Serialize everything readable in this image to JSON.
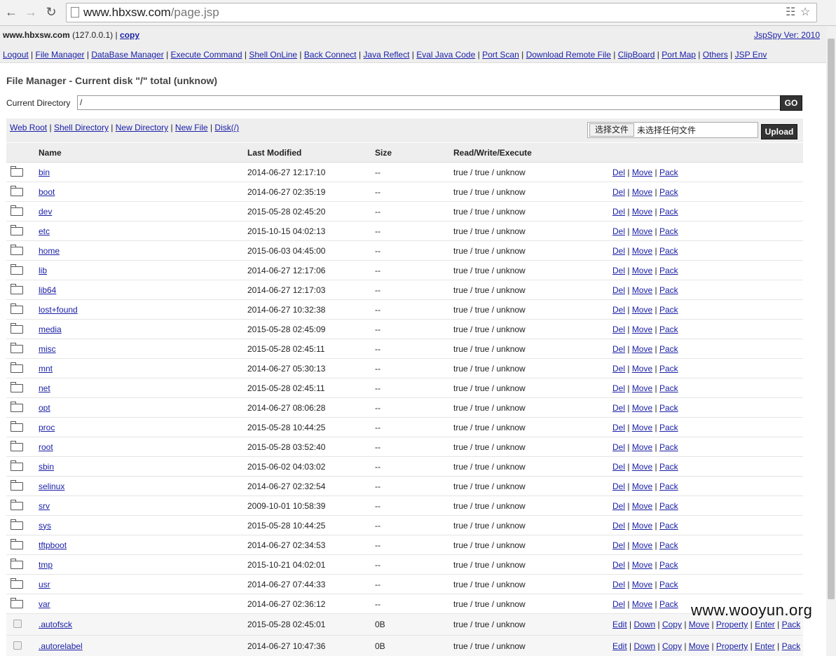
{
  "browser": {
    "url_host": "www.hbxsw.com",
    "url_path": "/page.jsp",
    "back_icon": "arrow-left",
    "forward_icon": "arrow-right",
    "reload_icon": "reload"
  },
  "header": {
    "host": "www.hbxsw.com",
    "ip": "(127.0.0.1)",
    "copy": "copy",
    "version": "JspSpy Ver: 2010"
  },
  "menu": [
    "Logout",
    "File Manager",
    "DataBase Manager",
    "Execute Command",
    "Shell OnLine",
    "Back Connect",
    "Java Reflect",
    "Eval Java Code",
    "Port Scan",
    "Download Remote File",
    "ClipBoard",
    "Port Map",
    "Others",
    "JSP Env"
  ],
  "title": "File Manager - Current disk \"/\" total (unknow)",
  "current_directory": {
    "label": "Current Directory",
    "value": "/",
    "go": "GO"
  },
  "tools": [
    "Web Root",
    "Shell Directory",
    "New Directory",
    "New File",
    "Disk(/)"
  ],
  "upload": {
    "choose": "选择文件",
    "no_file": "未选择任何文件",
    "button": "Upload"
  },
  "columns": {
    "name": "Name",
    "modified": "Last Modified",
    "size": "Size",
    "perm": "Read/Write/Execute"
  },
  "dir_actions": [
    "Del",
    "Move",
    "Pack"
  ],
  "file_actions": [
    "Edit",
    "Down",
    "Copy",
    "Move",
    "Property",
    "Enter",
    "Pack"
  ],
  "dirs": [
    {
      "name": "bin",
      "modified": "2014-06-27 12:17:10",
      "size": "--",
      "perm": "true / true / unknow"
    },
    {
      "name": "boot",
      "modified": "2014-06-27 02:35:19",
      "size": "--",
      "perm": "true / true / unknow"
    },
    {
      "name": "dev",
      "modified": "2015-05-28 02:45:20",
      "size": "--",
      "perm": "true / true / unknow"
    },
    {
      "name": "etc",
      "modified": "2015-10-15 04:02:13",
      "size": "--",
      "perm": "true / true / unknow"
    },
    {
      "name": "home",
      "modified": "2015-06-03 04:45:00",
      "size": "--",
      "perm": "true / true / unknow"
    },
    {
      "name": "lib",
      "modified": "2014-06-27 12:17:06",
      "size": "--",
      "perm": "true / true / unknow"
    },
    {
      "name": "lib64",
      "modified": "2014-06-27 12:17:03",
      "size": "--",
      "perm": "true / true / unknow"
    },
    {
      "name": "lost+found",
      "modified": "2014-06-27 10:32:38",
      "size": "--",
      "perm": "true / true / unknow"
    },
    {
      "name": "media",
      "modified": "2015-05-28 02:45:09",
      "size": "--",
      "perm": "true / true / unknow"
    },
    {
      "name": "misc",
      "modified": "2015-05-28 02:45:11",
      "size": "--",
      "perm": "true / true / unknow"
    },
    {
      "name": "mnt",
      "modified": "2014-06-27 05:30:13",
      "size": "--",
      "perm": "true / true / unknow"
    },
    {
      "name": "net",
      "modified": "2015-05-28 02:45:11",
      "size": "--",
      "perm": "true / true / unknow"
    },
    {
      "name": "opt",
      "modified": "2014-06-27 08:06:28",
      "size": "--",
      "perm": "true / true / unknow"
    },
    {
      "name": "proc",
      "modified": "2015-05-28 10:44:25",
      "size": "--",
      "perm": "true / true / unknow"
    },
    {
      "name": "root",
      "modified": "2015-05-28 03:52:40",
      "size": "--",
      "perm": "true / true / unknow"
    },
    {
      "name": "sbin",
      "modified": "2015-06-02 04:03:02",
      "size": "--",
      "perm": "true / true / unknow"
    },
    {
      "name": "selinux",
      "modified": "2014-06-27 02:32:54",
      "size": "--",
      "perm": "true / true / unknow"
    },
    {
      "name": "srv",
      "modified": "2009-10-01 10:58:39",
      "size": "--",
      "perm": "true / true / unknow"
    },
    {
      "name": "sys",
      "modified": "2015-05-28 10:44:25",
      "size": "--",
      "perm": "true / true / unknow"
    },
    {
      "name": "tftpboot",
      "modified": "2014-06-27 02:34:53",
      "size": "--",
      "perm": "true / true / unknow"
    },
    {
      "name": "tmp",
      "modified": "2015-10-21 04:02:01",
      "size": "--",
      "perm": "true / true / unknow"
    },
    {
      "name": "usr",
      "modified": "2014-06-27 07:44:33",
      "size": "--",
      "perm": "true / true / unknow"
    },
    {
      "name": "var",
      "modified": "2014-06-27 02:36:12",
      "size": "--",
      "perm": "true / true / unknow"
    }
  ],
  "files": [
    {
      "name": ".autofsck",
      "modified": "2015-05-28 02:45:01",
      "size": "0B",
      "perm": "true / true / unknow"
    },
    {
      "name": ".autorelabel",
      "modified": "2014-06-27 10:47:36",
      "size": "0B",
      "perm": "true / true / unknow"
    }
  ],
  "watermark": "www.wooyun.org"
}
